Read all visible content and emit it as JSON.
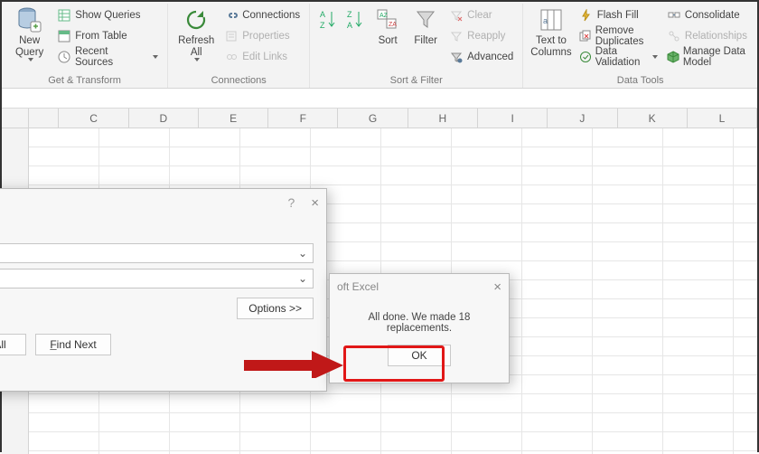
{
  "ribbon": {
    "groups": {
      "get_transform": {
        "label": "Get & Transform",
        "new_query": "New\nQuery",
        "show_queries": "Show Queries",
        "from_table": "From Table",
        "recent_sources": "Recent Sources"
      },
      "connections": {
        "label": "Connections",
        "refresh_all": "Refresh\nAll",
        "connections": "Connections",
        "properties": "Properties",
        "edit_links": "Edit Links"
      },
      "sort_filter": {
        "label": "Sort & Filter",
        "sort": "Sort",
        "filter": "Filter",
        "clear": "Clear",
        "reapply": "Reapply",
        "advanced": "Advanced"
      },
      "data_tools": {
        "label": "Data Tools",
        "text_to_columns": "Text to\nColumns",
        "flash_fill": "Flash Fill",
        "remove_duplicates": "Remove Duplicates",
        "data_validation": "Data Validation",
        "consolidate": "Consolidate",
        "relationships": "Relationships",
        "manage_data_model": "Manage Data Model"
      }
    }
  },
  "columns": [
    "C",
    "D",
    "E",
    "F",
    "G",
    "H",
    "I",
    "J",
    "K",
    "L"
  ],
  "find_dialog": {
    "help": "?",
    "close": "×",
    "options": "Options >>",
    "find_all": "Find All",
    "find_next": "Find Next"
  },
  "msg_dialog": {
    "title": "oft Excel",
    "close": "×",
    "text": "All done. We made 18 replacements.",
    "ok": "OK"
  }
}
